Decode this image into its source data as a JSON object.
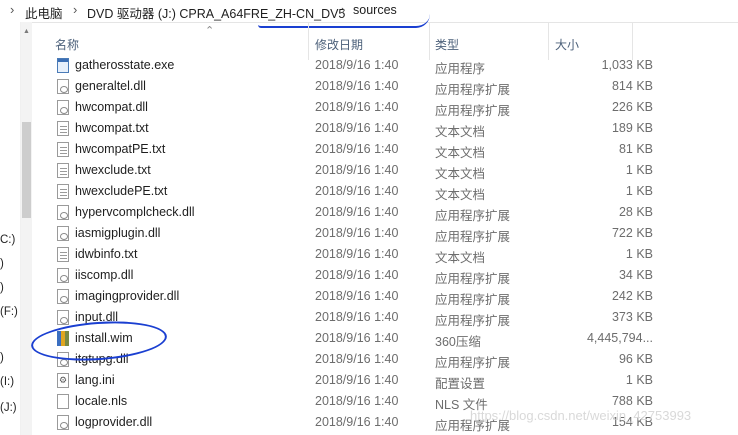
{
  "breadcrumb": [
    "此电脑",
    "DVD 驱动器 (J:) CPRA_A64FRE_ZH-CN_DV5",
    "sources"
  ],
  "nav_labels": [
    "C:)",
    ")",
    ")",
    "(F:)",
    ")",
    "(I:)",
    "(J:)"
  ],
  "columns": {
    "name": "名称",
    "date": "修改日期",
    "type": "类型",
    "size": "大小"
  },
  "files": [
    {
      "name": "gatherosstate.exe",
      "date": "2018/9/16 1:40",
      "type": "应用程序",
      "size": "1,033 KB",
      "icon": "exe-icon"
    },
    {
      "name": "generaltel.dll",
      "date": "2018/9/16 1:40",
      "type": "应用程序扩展",
      "size": "814 KB",
      "icon": "dll-icon"
    },
    {
      "name": "hwcompat.dll",
      "date": "2018/9/16 1:40",
      "type": "应用程序扩展",
      "size": "226 KB",
      "icon": "dll-icon"
    },
    {
      "name": "hwcompat.txt",
      "date": "2018/9/16 1:40",
      "type": "文本文档",
      "size": "189 KB",
      "icon": "txt-icon"
    },
    {
      "name": "hwcompatPE.txt",
      "date": "2018/9/16 1:40",
      "type": "文本文档",
      "size": "81 KB",
      "icon": "txt-icon"
    },
    {
      "name": "hwexclude.txt",
      "date": "2018/9/16 1:40",
      "type": "文本文档",
      "size": "1 KB",
      "icon": "txt-icon"
    },
    {
      "name": "hwexcludePE.txt",
      "date": "2018/9/16 1:40",
      "type": "文本文档",
      "size": "1 KB",
      "icon": "txt-icon"
    },
    {
      "name": "hypervcomplcheck.dll",
      "date": "2018/9/16 1:40",
      "type": "应用程序扩展",
      "size": "28 KB",
      "icon": "dll-icon"
    },
    {
      "name": "iasmigplugin.dll",
      "date": "2018/9/16 1:40",
      "type": "应用程序扩展",
      "size": "722 KB",
      "icon": "dll-icon"
    },
    {
      "name": "idwbinfo.txt",
      "date": "2018/9/16 1:40",
      "type": "文本文档",
      "size": "1 KB",
      "icon": "txt-icon"
    },
    {
      "name": "iiscomp.dll",
      "date": "2018/9/16 1:40",
      "type": "应用程序扩展",
      "size": "34 KB",
      "icon": "dll-icon"
    },
    {
      "name": "imagingprovider.dll",
      "date": "2018/9/16 1:40",
      "type": "应用程序扩展",
      "size": "242 KB",
      "icon": "dll-icon"
    },
    {
      "name": "input.dll",
      "date": "2018/9/16 1:40",
      "type": "应用程序扩展",
      "size": "373 KB",
      "icon": "dll-icon"
    },
    {
      "name": "install.wim",
      "date": "2018/9/16 1:40",
      "type": "360压缩",
      "size": "4,445,794...",
      "icon": "archive-icon"
    },
    {
      "name": "itgtupg.dll",
      "date": "2018/9/16 1:40",
      "type": "应用程序扩展",
      "size": "96 KB",
      "icon": "dll-icon"
    },
    {
      "name": "lang.ini",
      "date": "2018/9/16 1:40",
      "type": "配置设置",
      "size": "1 KB",
      "icon": "ini-icon"
    },
    {
      "name": "locale.nls",
      "date": "2018/9/16 1:40",
      "type": "NLS 文件",
      "size": "788 KB",
      "icon": "file-icon"
    },
    {
      "name": "logprovider.dll",
      "date": "2018/9/16 1:40",
      "type": "应用程序扩展",
      "size": "154 KB",
      "icon": "dll-icon"
    }
  ],
  "watermark": "https://blog.csdn.net/weixin_42753993"
}
